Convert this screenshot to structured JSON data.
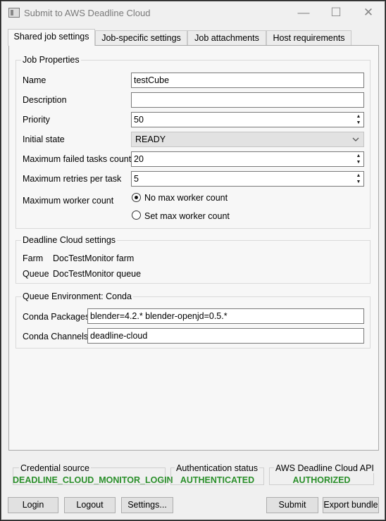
{
  "window": {
    "title": "Submit to AWS Deadline Cloud"
  },
  "tabs": [
    {
      "label": "Shared job settings"
    },
    {
      "label": "Job-specific settings"
    },
    {
      "label": "Job attachments"
    },
    {
      "label": "Host requirements"
    }
  ],
  "job_properties": {
    "group_title": "Job Properties",
    "name_label": "Name",
    "name_value": "testCube",
    "description_label": "Description",
    "description_value": "",
    "priority_label": "Priority",
    "priority_value": "50",
    "initial_state_label": "Initial state",
    "initial_state_value": "READY",
    "max_failed_label": "Maximum failed tasks count",
    "max_failed_value": "20",
    "max_retries_label": "Maximum retries per task",
    "max_retries_value": "5",
    "max_worker_label": "Maximum worker count",
    "no_max_label": "No max worker count",
    "set_max_label": "Set max worker count"
  },
  "deadline_settings": {
    "group_title": "Deadline Cloud settings",
    "farm_label": "Farm",
    "farm_value": "DocTestMonitor farm",
    "queue_label": "Queue",
    "queue_value": "DocTestMonitor queue"
  },
  "queue_env": {
    "group_title": "Queue Environment: Conda",
    "packages_label": "Conda Packages",
    "packages_value": "blender=4.2.* blender-openjd=0.5.*",
    "channels_label": "Conda Channels",
    "channels_value": "deadline-cloud"
  },
  "status": {
    "credential_label": "Credential source",
    "credential_value": "DEADLINE_CLOUD_MONITOR_LOGIN",
    "auth_label": "Authentication status",
    "auth_value": "AUTHENTICATED",
    "api_label": "AWS Deadline Cloud API",
    "api_value": "AUTHORIZED",
    "ok_color": "#2a8f2a"
  },
  "buttons": {
    "login": "Login",
    "logout": "Logout",
    "settings": "Settings...",
    "submit": "Submit",
    "export": "Export bundle"
  }
}
